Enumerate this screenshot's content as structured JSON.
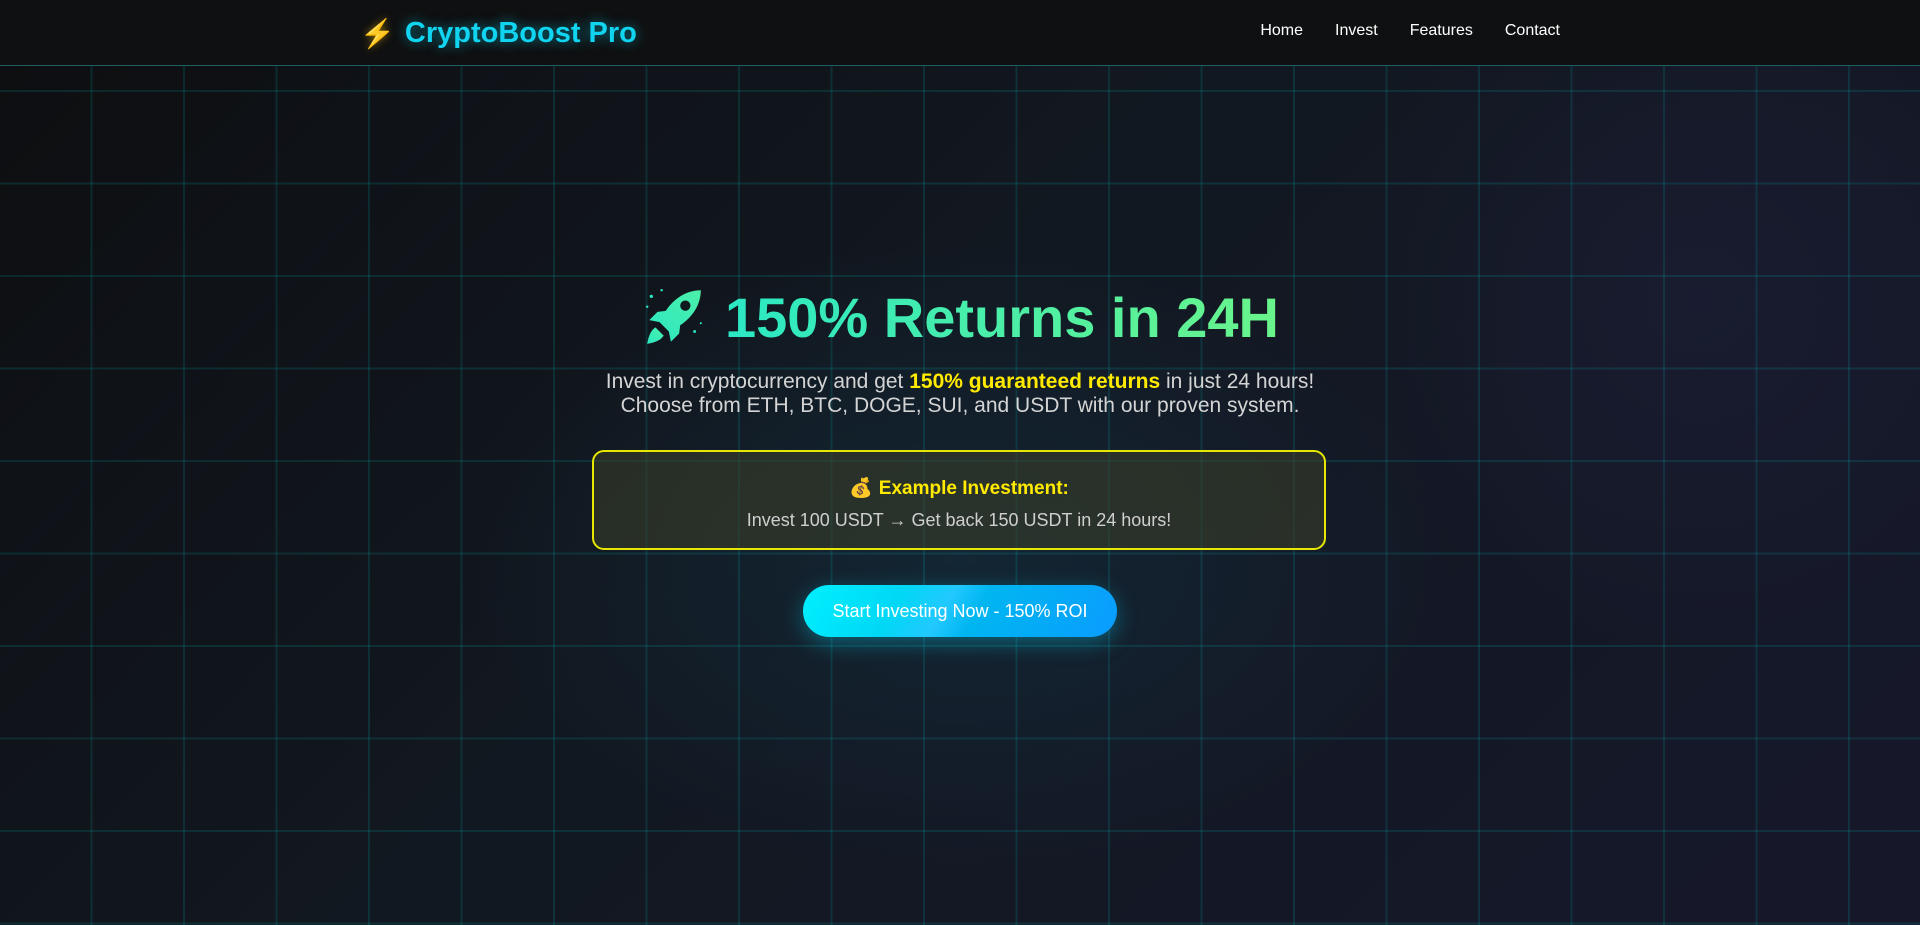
{
  "header": {
    "logo_icon": "lightning-bolt-icon",
    "logo_bolt": "⚡",
    "logo_text": "CryptoBoost Pro",
    "nav": [
      "Home",
      "Invest",
      "Features",
      "Contact"
    ]
  },
  "hero": {
    "title_icon": "rocket-icon",
    "title": "150% Returns in 24H",
    "subtitle_pre": "Invest in cryptocurrency and get ",
    "subtitle_highlight": "150% guaranteed returns",
    "subtitle_post": " in just 24 hours!",
    "subtitle_line2": "Choose from ETH, BTC, DOGE, SUI, and USDT with our proven system.",
    "example": {
      "icon": "money-bag-icon",
      "icon_glyph": "💰",
      "title": "Example Investment:",
      "text": "Invest 100 USDT → Get back 150 USDT in 24 hours!"
    },
    "cta_label": "Start Investing Now - 150% ROI"
  },
  "colors": {
    "accent_cyan": "#10d4f0",
    "highlight_yellow": "#ffea00",
    "title_green": "#6af48a",
    "header_bg": "#0f1011"
  }
}
